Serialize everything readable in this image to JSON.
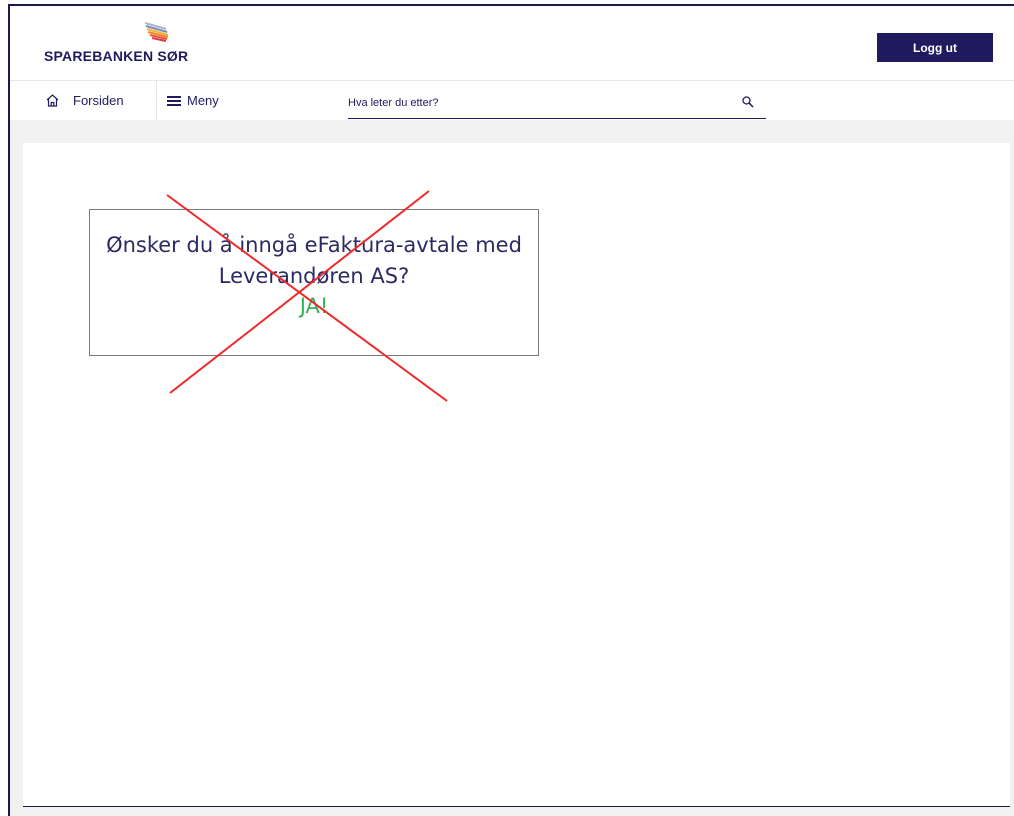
{
  "header": {
    "brand_name": "SPAREBANKEN SØR",
    "logout_label": "Logg ut"
  },
  "nav": {
    "home_label": "Forsiden",
    "menu_label": "Meny",
    "search_placeholder": "Hva leter du etter?"
  },
  "dialog": {
    "question": "Ønsker du å inngå eFaktura-avtale med Leverandøren AS?",
    "answer": "JA!"
  },
  "colors": {
    "brand": "#1f1b5e",
    "answer": "#35b159",
    "cross": "#ee2a2a"
  },
  "icons": {
    "logo": "sparebanken-sor-logo-icon",
    "home": "house-icon",
    "menu": "hamburger-icon",
    "search": "search-icon"
  }
}
